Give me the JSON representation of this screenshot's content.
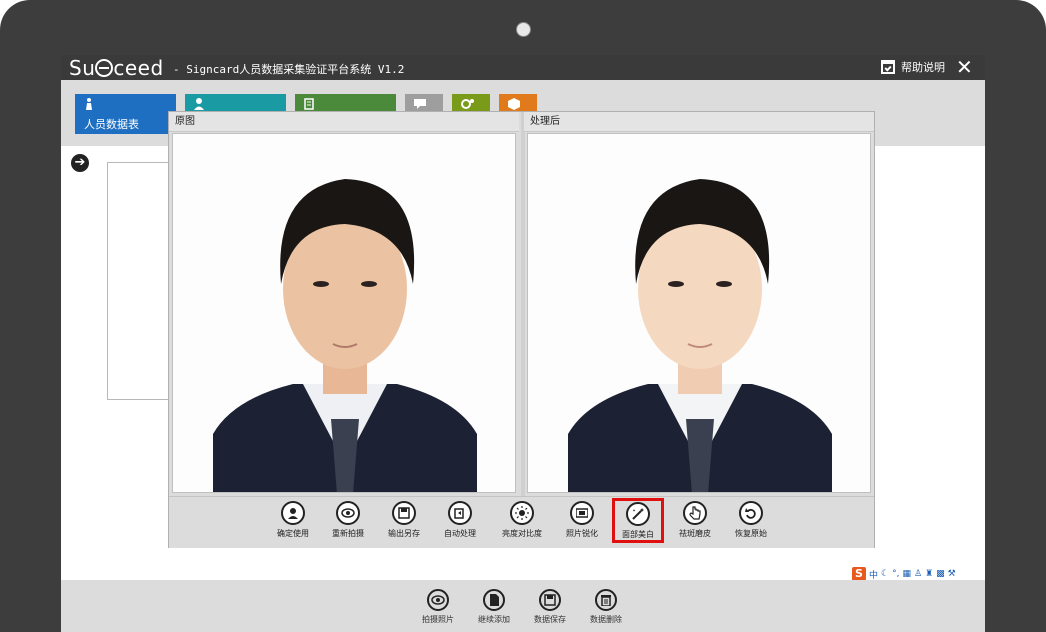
{
  "app": {
    "logo": "Su",
    "logo_tail": "ceed",
    "title": "- Signcard人员数据采集验证平台系统 V1.2",
    "help_label": "帮助说明",
    "close_glyph": "✕"
  },
  "nav_tabs": [
    {
      "label": "人员数据表",
      "color": "#1e6fc2",
      "icon": "person-tie-icon"
    },
    {
      "label": "",
      "color": "#1a9aa3",
      "icon": "user-icon"
    },
    {
      "label": "",
      "color": "#4a8a3a",
      "icon": "list-icon"
    },
    {
      "label": "",
      "color": "#9e9e9e",
      "icon": "chat-icon"
    },
    {
      "label": "",
      "color": "#7a9a1a",
      "icon": "settings-icon"
    },
    {
      "label": "",
      "color": "#e07a1a",
      "icon": "box-icon"
    }
  ],
  "dialog": {
    "left_pane_title": "原图",
    "right_pane_title": "处理后",
    "toolbar": [
      {
        "label": "确定使用",
        "icon": "person-icon",
        "glyph": "👤"
      },
      {
        "label": "重新拍摄",
        "icon": "eye-icon",
        "glyph": "◉"
      },
      {
        "label": "输出另存",
        "icon": "save-icon",
        "glyph": "💾"
      },
      {
        "label": "自动处理",
        "icon": "auto-process-icon",
        "glyph": "⧉"
      },
      {
        "label": "亮度对比度",
        "icon": "brightness-icon",
        "glyph": "☀"
      },
      {
        "label": "照片锐化",
        "icon": "sharpen-icon",
        "glyph": "▦"
      },
      {
        "label": "面部美白",
        "icon": "magic-wand-icon",
        "glyph": "✦"
      },
      {
        "label": "祛斑磨皮",
        "icon": "smooth-skin-icon",
        "glyph": "☝"
      },
      {
        "label": "恢复原始",
        "icon": "undo-icon",
        "glyph": "↶"
      }
    ],
    "active_tool_index": 6
  },
  "bottom_bar": [
    {
      "label": "拍摄照片",
      "icon": "eye-icon",
      "glyph": "◉"
    },
    {
      "label": "继续添加",
      "icon": "document-icon",
      "glyph": "▤"
    },
    {
      "label": "数据保存",
      "icon": "save-icon",
      "glyph": "💾"
    },
    {
      "label": "数据删除",
      "icon": "trash-icon",
      "glyph": "🗑"
    }
  ],
  "tray": {
    "ime_logo": "S",
    "ime_mode": "中"
  },
  "colors": {
    "titlebar": "#3a3a3a",
    "highlight": "#e01010"
  }
}
